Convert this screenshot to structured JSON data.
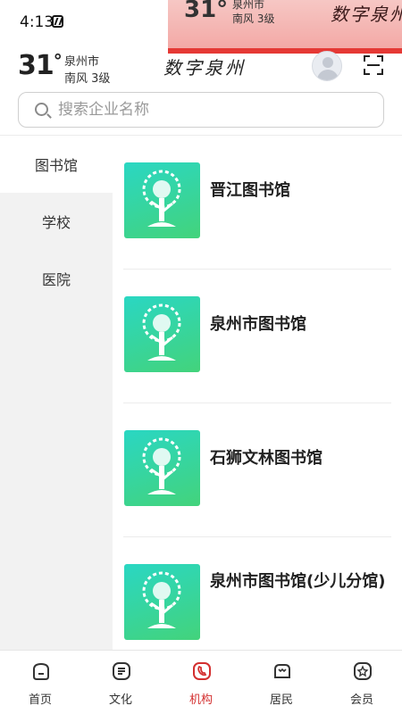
{
  "status_bar": {
    "time": "4:13"
  },
  "overlay": {
    "temperature": "31°",
    "city": "泉州市",
    "wind": "南风  3级",
    "brand": "数字泉州"
  },
  "header": {
    "temperature": "31",
    "degree_symbol": "°",
    "city": "泉州市",
    "wind": "南风  3级",
    "brand": "数字泉州"
  },
  "search": {
    "placeholder": "搜索企业名称",
    "value": ""
  },
  "sidebar": {
    "items": [
      {
        "label": "图书馆",
        "active": true
      },
      {
        "label": "学校",
        "active": false
      },
      {
        "label": "医院",
        "active": false
      }
    ]
  },
  "list": {
    "items": [
      {
        "name": "晋江图书馆"
      },
      {
        "name": "泉州市图书馆"
      },
      {
        "name": "石狮文林图书馆"
      },
      {
        "name": "泉州市图书馆(少儿分馆)"
      }
    ]
  },
  "bottom_nav": {
    "tabs": [
      {
        "label": "首页",
        "icon": "home-icon",
        "active": false
      },
      {
        "label": "文化",
        "icon": "culture-icon",
        "active": false
      },
      {
        "label": "机构",
        "icon": "institution-icon",
        "active": true
      },
      {
        "label": "居民",
        "icon": "residents-icon",
        "active": false
      },
      {
        "label": "会员",
        "icon": "member-icon",
        "active": false
      }
    ]
  },
  "colors": {
    "accent": "#d32f2f",
    "thumb_gradient_start": "#2ad7c3",
    "thumb_gradient_end": "#43d37b",
    "sidebar_bg": "#f2f2f2",
    "overlay_bar": "#e53935"
  }
}
